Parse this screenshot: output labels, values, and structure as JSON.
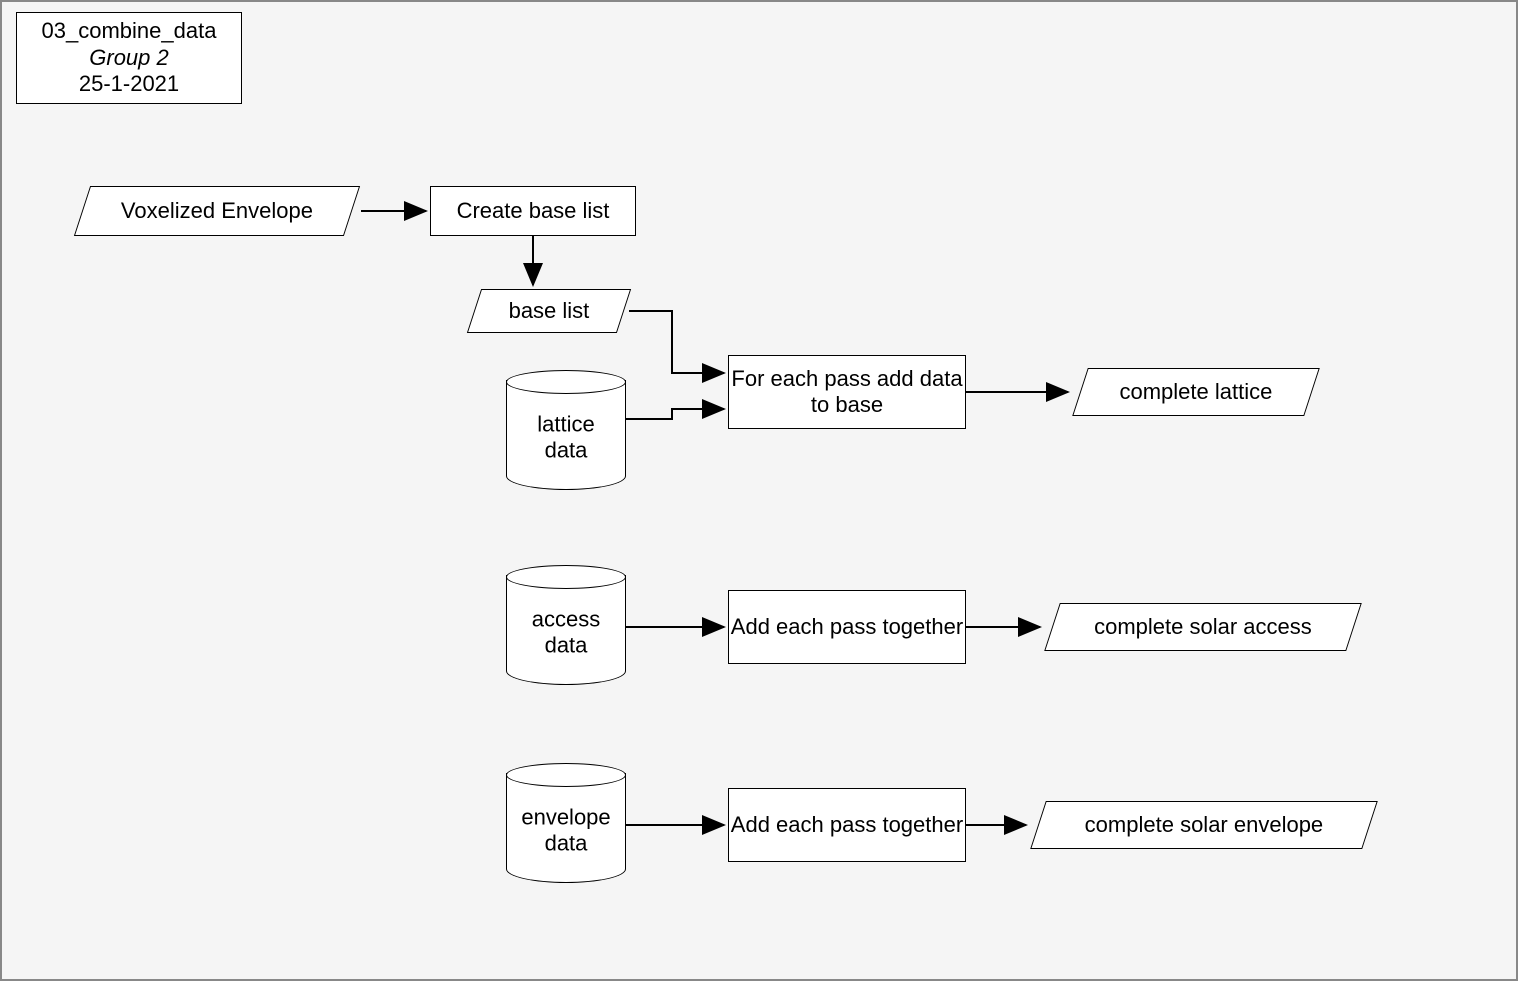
{
  "title": {
    "line1": "03_combine_data",
    "line2": "Group 2",
    "line3": "25-1-2021"
  },
  "nodes": {
    "voxelized_envelope": "Voxelized Envelope",
    "create_base_list": "Create base list",
    "base_list": "base list",
    "lattice_data": "lattice data",
    "for_each_pass": "For each pass add data to base",
    "complete_lattice": "complete lattice",
    "access_data": "access data",
    "add_access": "Add each pass together",
    "complete_solar_access": "complete solar access",
    "envelope_data": "envelope data",
    "add_envelope": "Add each pass together",
    "complete_solar_envelope": "complete solar envelope"
  }
}
